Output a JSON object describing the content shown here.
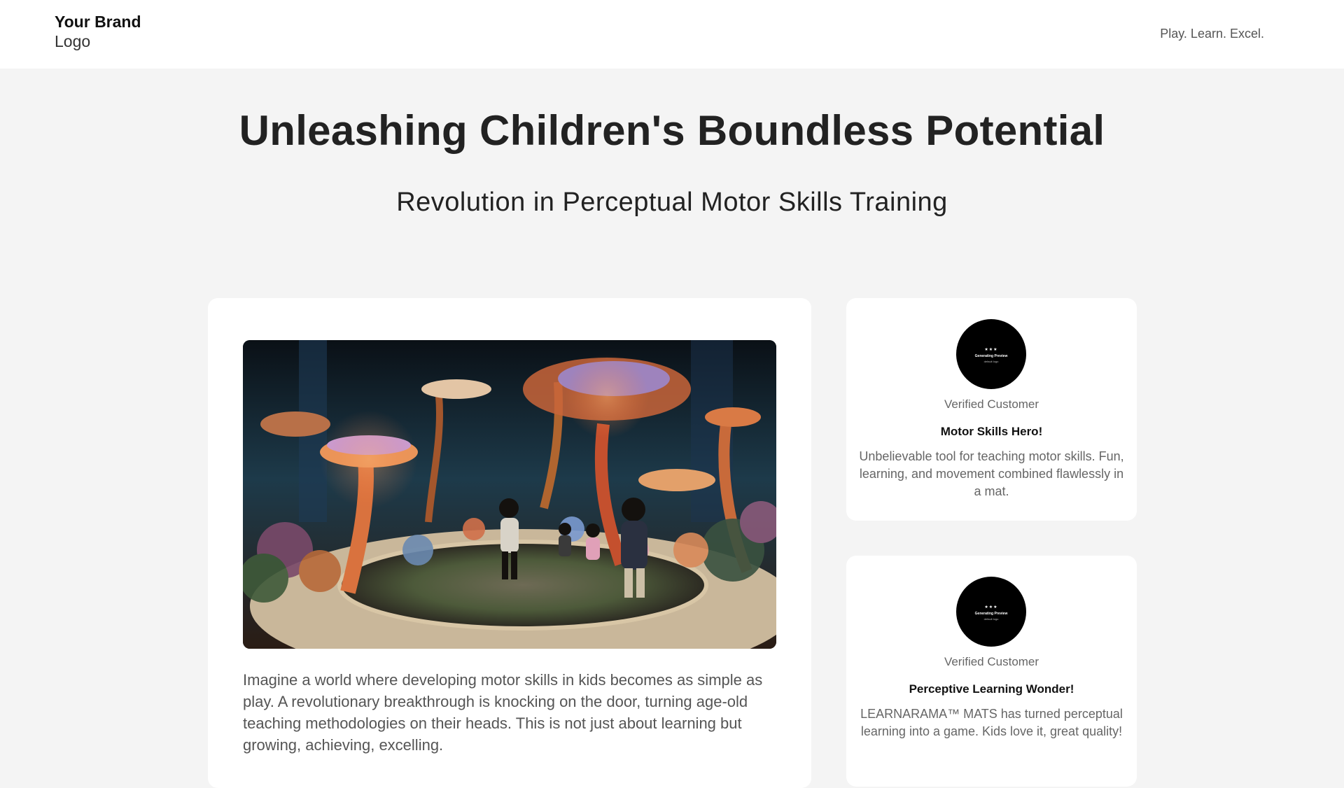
{
  "header": {
    "brand_name": "Your Brand",
    "brand_logo": "Logo",
    "tagline": "Play. Learn. Excel."
  },
  "hero": {
    "title": "Unleashing Children's Boundless Potential",
    "subtitle": "Revolution in Perceptual Motor Skills Training"
  },
  "main": {
    "image_alt": "Children exploring an immersive fantasy garden exhibit with giant glowing mushrooms and flowers",
    "paragraph": "Imagine a world where developing motor skills in kids becomes as simple as play. A revolutionary breakthrough is knocking on the door, turning age-old teaching methodologies on their heads. This is not just about learning but growing, achieving, excelling."
  },
  "reviews": [
    {
      "avatar_stars": "★★★",
      "avatar_text": "Generating Preview",
      "avatar_sub": "default logo",
      "label": "Verified Customer",
      "title": "Motor Skills Hero!",
      "body": "Unbelievable tool for teaching motor skills. Fun, learning, and movement combined flawlessly in a mat."
    },
    {
      "avatar_stars": "★★★",
      "avatar_text": "Generating Preview",
      "avatar_sub": "default logo",
      "label": "Verified Customer",
      "title": "Perceptive Learning Wonder!",
      "body": "LEARNARAMA™ MATS has turned perceptual learning into a game. Kids love it, great quality!"
    }
  ],
  "colors": {
    "page_bg": "#f4f4f4",
    "card_bg": "#ffffff",
    "text_dark": "#222222",
    "text_muted": "#666666"
  }
}
